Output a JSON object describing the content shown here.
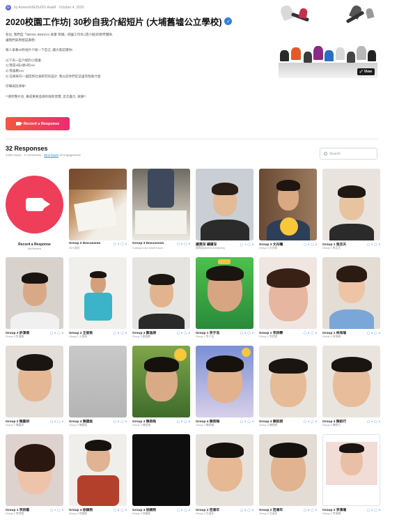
{
  "meta": {
    "avatar": "G",
    "author": "by AnnieshihEDu001 AaaM",
    "date": "October 4, 2020"
  },
  "title": "2020校園工作坊| 30秒自我介紹短片 (大埔舊墟公立學校)",
  "description": [
    "各位, 我們是「BEING BEINGS 覓隱·尋隱」校園工作坊 (週小組)的教學團隊,",
    "讓我們來用相認識吧!",
    "",
    "每人拿著30秒短片介紹一下自己, 讓大家認識你!",
    "",
    "以下為一些介紹的小建議:",
    "1) 我是x班x號x的xxx",
    "2) 我喜歡xxx",
    "3) 在將來的一個回到社會研究的設計, 我以前你們在這里有帮助什麼",
    "",
    "仔細與說清晰!",
    "",
    "**請完整片段, 養成重要品德的錄影習慣, 這次盡力, 謝謝**"
  ],
  "record_button": "Record a Response",
  "hero": {
    "view_label": "View"
  },
  "responses": {
    "title": "32 Responses",
    "views": "3430 views",
    "comments": "2 comments",
    "hours": "26.6 hours",
    "engagement": "of engagement",
    "search_placeholder": "Search"
  },
  "record_card": {
    "label": "Record a Response",
    "sub": "Moderated"
  },
  "cards": [
    {
      "name": "Group 2 Discussion",
      "author": "30人說好",
      "views": "0",
      "comments": "0",
      "likes": "8"
    },
    {
      "name": "Group 3 Discussion",
      "author": "Coding to our smart future",
      "views": "0",
      "comments": "0",
      "likes": "8"
    },
    {
      "name": "譚潤深 譚譚深",
      "author": "譚潤深(BeeW Architects)",
      "views": "1",
      "comments": "0",
      "likes": "8"
    },
    {
      "name": "Group 3 文光曦",
      "author": "Group 3 文光曦",
      "views": "0",
      "comments": "0",
      "likes": "8"
    },
    {
      "name": "Group 1 馬亞天",
      "author": "Group 1 馬亞天",
      "views": "0",
      "comments": "0",
      "likes": "8"
    },
    {
      "name": "Group 3 許漢傑",
      "author": "Group 3 許漢傑",
      "views": "0",
      "comments": "0",
      "likes": "8"
    },
    {
      "name": "Group 2 王俊致",
      "author": "Group 2 王俊致",
      "views": "0",
      "comments": "0",
      "likes": "8"
    },
    {
      "name": "Group 3 鄭逸朗",
      "author": "Group 3 鄭逸朗",
      "views": "0",
      "comments": "0",
      "likes": "8"
    },
    {
      "name": "Group 1 李子浩",
      "author": "Group 1 李子浩",
      "views": "0",
      "comments": "0",
      "likes": "8"
    },
    {
      "name": "Group 1 李詩霖",
      "author": "Group 1 李詩霖",
      "views": "0",
      "comments": "0",
      "likes": "8"
    },
    {
      "name": "Group 1 林海瑜",
      "author": "Group 1 林海瑜",
      "views": "0",
      "comments": "0",
      "likes": "8"
    },
    {
      "name": "Group 2 陳嘉妍",
      "author": "Group 2 陳嘉妍",
      "views": "0",
      "comments": "0",
      "likes": "8"
    },
    {
      "name": "Group 4 陳建銘",
      "author": "Group 4 陳建銘",
      "views": "0",
      "comments": "0",
      "likes": "8"
    },
    {
      "name": "Group 3 陳君皓",
      "author": "Group 3 陳君皓",
      "views": "0",
      "comments": "0",
      "likes": "8"
    },
    {
      "name": "Group 4 陳君翰",
      "author": "Group 4 陳君翰",
      "views": "0",
      "comments": "0",
      "likes": "8"
    },
    {
      "name": "Group 4 陳栢朗",
      "author": "Group 4 陳栢朗",
      "views": "0",
      "comments": "0",
      "likes": "7"
    },
    {
      "name": "Group 4 陳栢行",
      "author": "Group 4 陳栢行",
      "views": "0",
      "comments": "0",
      "likes": "8"
    },
    {
      "name": "Group 1 李詩霞",
      "author": "Group 1 李詩霞",
      "views": "1",
      "comments": "0",
      "likes": "7"
    },
    {
      "name": "Group 4 徐穎熙",
      "author": "Group 4 徐穎熙",
      "views": "0",
      "comments": "0",
      "likes": "8"
    },
    {
      "name": "Group 4 徐穎熙",
      "author": "Group 4 徐穎熙",
      "views": "0",
      "comments": "0",
      "likes": "8"
    },
    {
      "name": "Group 2 范達年",
      "author": "Group 2 范達年",
      "views": "0",
      "comments": "0",
      "likes": "8"
    },
    {
      "name": "Group 2 范達年",
      "author": "Group 2 范達年",
      "views": "0",
      "comments": "0",
      "likes": "8"
    },
    {
      "name": "Group 2 李澤瀚",
      "author": "Group 2 李澤瀚",
      "views": "0",
      "comments": "0",
      "likes": "8"
    }
  ]
}
